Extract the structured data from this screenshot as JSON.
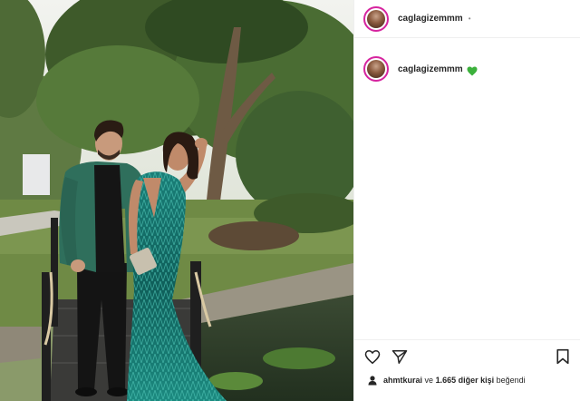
{
  "post": {
    "author": {
      "username": "caglagizemmm",
      "avatar_icon": "profile-photo",
      "ring_color": "#d6249f"
    },
    "header_dot": "•",
    "caption": {
      "username": "caglagizemmm",
      "emoji_icon": "green-heart-icon",
      "emoji_color": "#3cb13c"
    },
    "actions": {
      "like_icon": "heart-outline-icon",
      "share_icon": "paper-plane-icon",
      "save_icon": "bookmark-icon"
    },
    "likes": {
      "liker_avatar_icon": "user-avatar-icon",
      "liker": "ahmtkurai",
      "connector": "ve",
      "others": "1.665 diğer kişi",
      "suffix": "beğendi"
    }
  },
  "photo": {
    "description_icon": "couple-garden-photo"
  }
}
